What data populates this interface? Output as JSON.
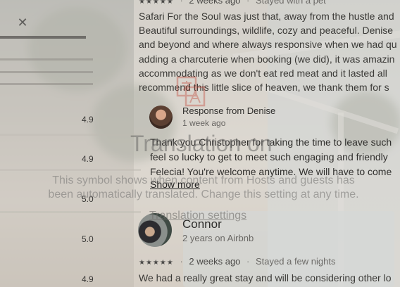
{
  "close_icon": "close-icon",
  "category_scores": [
    "4.9",
    "4.9",
    "5.0",
    "5.0",
    "4.9"
  ],
  "review_1": {
    "rating": "★★★★★",
    "date": "2 weeks ago",
    "stay": "Stayed with a pet",
    "lines": [
      "Safari For the Soul was just that, away from the hustle and",
      "Beautiful surroundings, wildlife, cozy and peaceful. Denise",
      "and beyond and where always responsive when we had qu",
      "adding a charcuterie when booking (we did), it was amazin",
      "accommodating as we don't eat red meat and it lasted all",
      "recommend this little slice of heaven, we thank them for s"
    ]
  },
  "host_response": {
    "title": "Response from Denise",
    "date": "1 week ago",
    "lines": [
      "Thank you Christopher for taking the time to leave such",
      "feel so lucky to get to meet such engaging and friendly",
      "Felecia! You're welcome anytime. We will have to come"
    ],
    "show_more": "Show more"
  },
  "review_2": {
    "name": "Connor",
    "tenure": "2 years on Airbnb",
    "rating": "★★★★★",
    "date": "2 weeks ago",
    "stay": "Stayed a few nights",
    "first_line": "We had a really great stay and will be considering other lo"
  },
  "translation_tooltip": {
    "icon": "translate-icon",
    "title": "Translation on",
    "body_line_1": "This symbol shows when content from Hosts and guests has",
    "body_line_2": "been automatically translated. Change this setting at any time.",
    "settings_link": "Translation settings"
  }
}
